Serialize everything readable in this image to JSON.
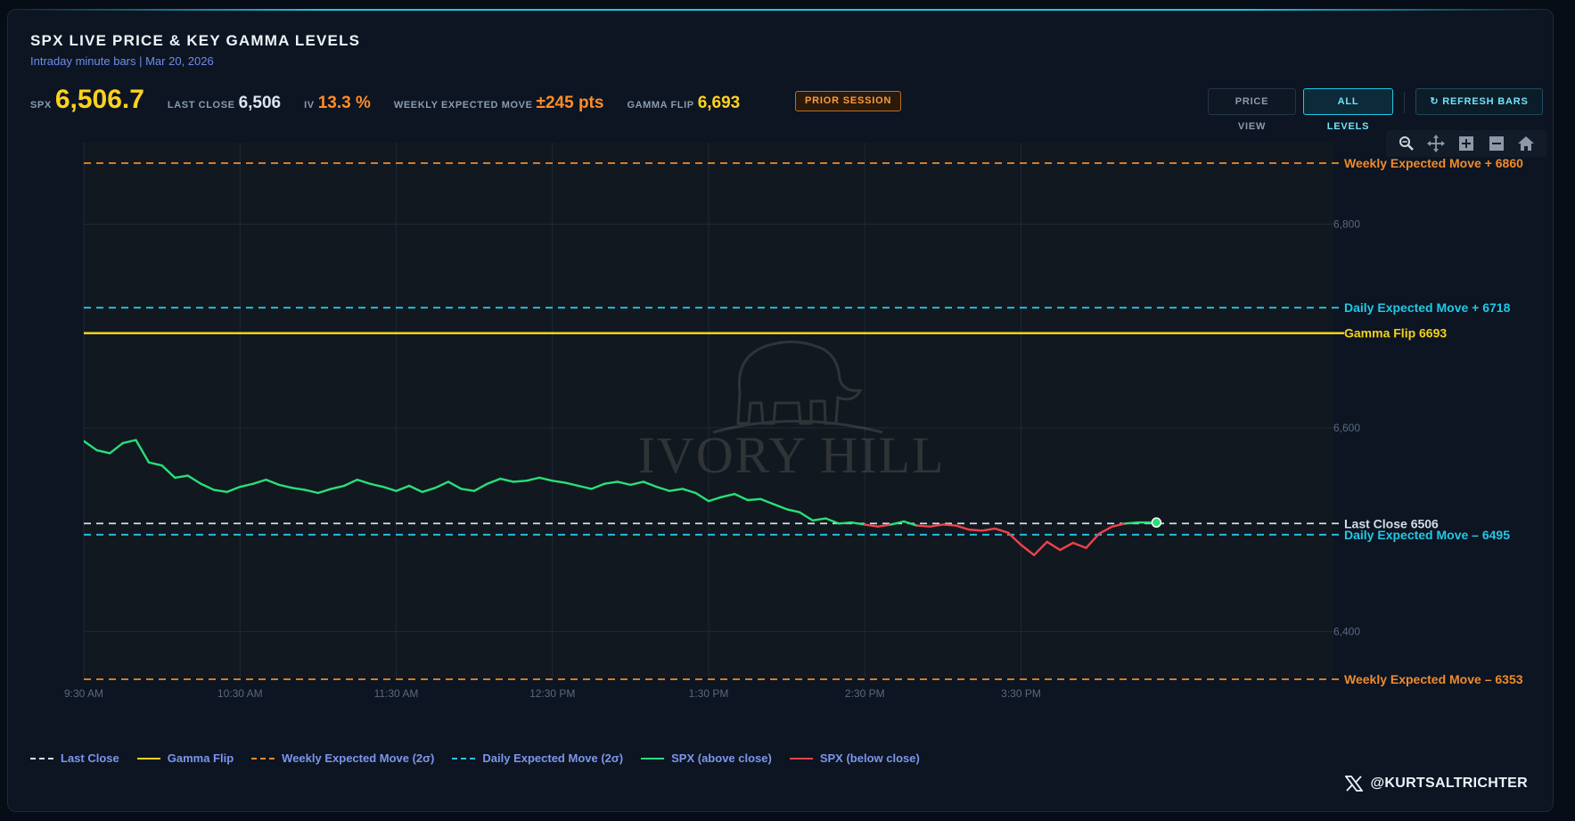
{
  "header": {
    "title": "SPX LIVE PRICE & KEY GAMMA LEVELS",
    "subtitle": "Intraday minute bars | Mar 20, 2026"
  },
  "stats": {
    "spx_label": "SPX",
    "spx_value": "6,506.7",
    "last_close_label": "LAST CLOSE",
    "last_close_value": "6,506",
    "iv_label": "IV",
    "iv_value": "13.3 %",
    "wem_label": "WEEKLY EXPECTED MOVE",
    "wem_value": "±245 pts",
    "gamma_flip_label": "GAMMA FLIP",
    "gamma_flip_value": "6,693",
    "session_badge": "PRIOR SESSION"
  },
  "controls": {
    "price_view": "PRICE VIEW",
    "all_levels": "ALL LEVELS",
    "refresh": "↻ REFRESH BARS",
    "tools": [
      "zoom-icon",
      "pan-icon",
      "zoom-in-icon",
      "zoom-out-icon",
      "home-icon"
    ]
  },
  "watermark": {
    "text": "IVORY HILL"
  },
  "colors": {
    "green": "#27e07a",
    "red": "#f0424a",
    "orange": "#f08a2c",
    "cyan": "#22c8e6",
    "yellow": "#f5d11c",
    "white": "#d6dce6"
  },
  "chart_data": {
    "type": "line",
    "x_ticks": [
      "9:30 AM",
      "10:30 AM",
      "11:30 AM",
      "12:30 PM",
      "1:30 PM",
      "2:30 PM",
      "3:30 PM"
    ],
    "y_ticks": [
      6400,
      6600,
      6800
    ],
    "y_tick_labels": [
      "6,400",
      "6,600",
      "6,800"
    ],
    "ylim": [
      6340,
      6880
    ],
    "x_range_minutes": [
      0,
      412
    ],
    "levels": [
      {
        "name": "Weekly Expected Move +",
        "value": 6860,
        "label": "Weekly Expected Move +  6860",
        "style": "dash",
        "color": "#f08a2c"
      },
      {
        "name": "Daily Expected Move +",
        "value": 6718,
        "label": "Daily Expected Move +  6718",
        "style": "dash",
        "color": "#22c8e6"
      },
      {
        "name": "Gamma Flip",
        "value": 6693,
        "label": "Gamma Flip  6693",
        "style": "solid",
        "color": "#f5d11c"
      },
      {
        "name": "Last Close",
        "value": 6506,
        "label": "Last Close  6506",
        "style": "dash",
        "color": "#d6dce6"
      },
      {
        "name": "Daily Expected Move –",
        "value": 6495,
        "label": "Daily Expected Move –  6495",
        "style": "dash",
        "color": "#22c8e6"
      },
      {
        "name": "Weekly Expected Move –",
        "value": 6353,
        "label": "Weekly Expected Move –  6353",
        "style": "dash",
        "color": "#f08a2c"
      }
    ],
    "series": [
      {
        "x_minutes": [
          0,
          5,
          10,
          15,
          20,
          25,
          30,
          35,
          40,
          45,
          50,
          55,
          60,
          65,
          70,
          75,
          80,
          85,
          90,
          95,
          100,
          105,
          110,
          115,
          120,
          125,
          130,
          135,
          140,
          145,
          150,
          155,
          160,
          165,
          170,
          175,
          180,
          185,
          190,
          195,
          200,
          205,
          210,
          215,
          220,
          225,
          230,
          235,
          240,
          245,
          250,
          255,
          260,
          265,
          270,
          275,
          280,
          285,
          290,
          295,
          300,
          305,
          310,
          315,
          320,
          325,
          330,
          335,
          340,
          345,
          350,
          355,
          360,
          365,
          370,
          375,
          380,
          385,
          390,
          395,
          400,
          405,
          410,
          412
        ],
        "values": [
          6587,
          6578,
          6575,
          6585,
          6588,
          6566,
          6563,
          6551,
          6553,
          6545,
          6539,
          6537,
          6542,
          6545,
          6549,
          6544,
          6541,
          6539,
          6536,
          6540,
          6543,
          6549,
          6545,
          6542,
          6538,
          6543,
          6537,
          6541,
          6547,
          6540,
          6538,
          6545,
          6550,
          6547,
          6548,
          6551,
          6548,
          6546,
          6543,
          6540,
          6545,
          6547,
          6544,
          6547,
          6542,
          6538,
          6540,
          6536,
          6528,
          6532,
          6535,
          6529,
          6530,
          6525,
          6520,
          6517,
          6509,
          6511,
          6506,
          6507,
          6505,
          6503,
          6505,
          6508,
          6504,
          6503,
          6505,
          6504,
          6500,
          6499,
          6501,
          6497,
          6485,
          6475,
          6488,
          6480,
          6487,
          6482,
          6496,
          6503,
          6506,
          6507,
          6507,
          6507
        ]
      }
    ],
    "last_point": {
      "x_minutes": 412,
      "value": 6507
    }
  },
  "legend": {
    "items": [
      {
        "label": "Last Close",
        "style": "dash",
        "color": "#d6dce6"
      },
      {
        "label": "Gamma Flip",
        "style": "solid",
        "color": "#f5d11c"
      },
      {
        "label": "Weekly Expected Move (2σ)",
        "style": "dash",
        "color": "#f08a2c"
      },
      {
        "label": "Daily Expected Move (2σ)",
        "style": "dash",
        "color": "#22c8e6"
      },
      {
        "label": "SPX (above close)",
        "style": "solid",
        "color": "#27e07a"
      },
      {
        "label": "SPX (below close)",
        "style": "solid",
        "color": "#f0424a"
      }
    ]
  },
  "footer": {
    "handle": "@KURTSALTRICHTER"
  }
}
